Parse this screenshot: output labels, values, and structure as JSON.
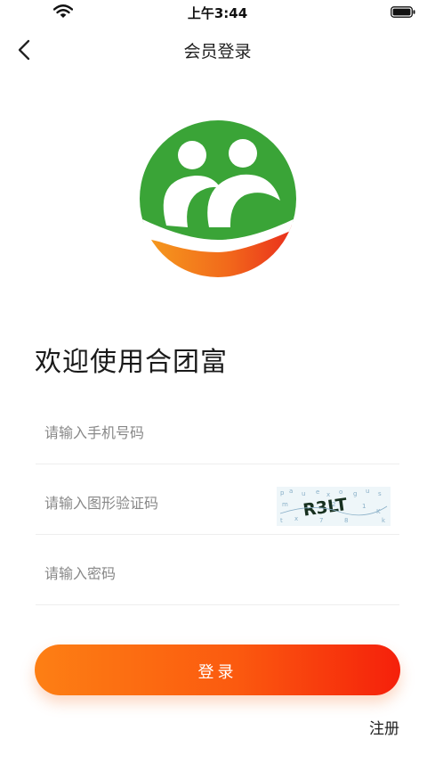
{
  "status_bar": {
    "time": "上午3:44",
    "wifi_icon": "wifi-icon",
    "battery_icon": "battery-icon"
  },
  "nav": {
    "back_icon": "chevron-left-icon",
    "title": "会员登录"
  },
  "logo": {
    "icon": "app-logo",
    "colors": {
      "green": "#3aa437",
      "orange": "#f47e1c",
      "red": "#ee2a1e"
    }
  },
  "welcome": "欢迎使用合团富",
  "form": {
    "phone_placeholder": "请输入手机号码",
    "captcha_placeholder": "请输入图形验证码",
    "captcha_text": "R3LT",
    "password_placeholder": "请输入密码"
  },
  "login_button": {
    "label": "登录",
    "gradient": [
      "#fd7f14",
      "#f5200b"
    ]
  },
  "register_link": "注册"
}
